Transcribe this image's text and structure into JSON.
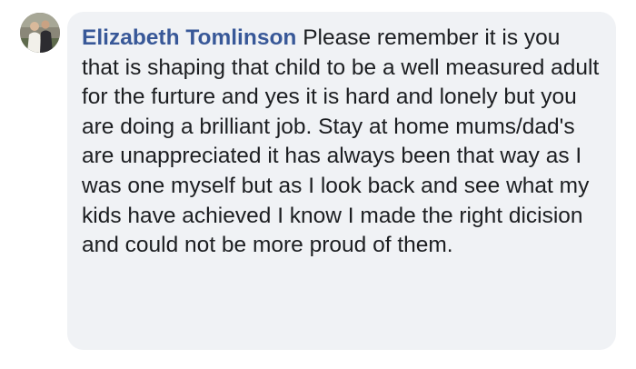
{
  "comment": {
    "author": "Elizabeth Tomlinson",
    "text": "Please remember it is you that is shaping that child to be a well measured adult for the furture and yes it is hard and lonely but you are doing a brilliant job. Stay at home mums/dad's are unappreciated it has always been that way as I was one myself but as I look back and see what my kids have achieved I know I made the right dicision and could not be more proud of them.",
    "avatar_icon": "user-avatar-photo"
  },
  "colors": {
    "author_name": "#385898",
    "bubble_background": "#f0f2f5",
    "text": "#1c1e21"
  }
}
